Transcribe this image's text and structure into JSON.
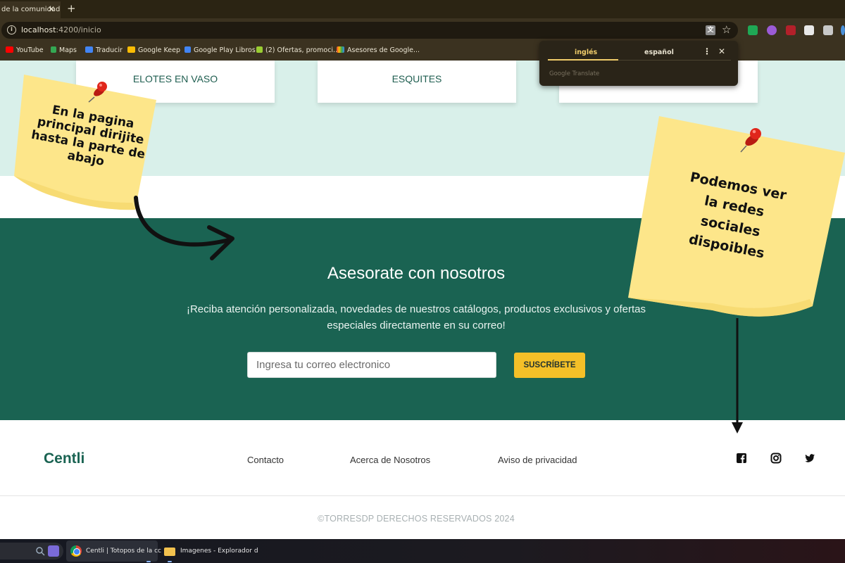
{
  "browser": {
    "tab_title": "de la comunidad",
    "tab_close": "✕",
    "new_tab": "+",
    "url_host": "localhost",
    "url_path": ":4200/inicio",
    "info": "i",
    "translate_glyph": "文",
    "star": "☆"
  },
  "bookmarks": [
    {
      "label": "YouTube",
      "color": "#ff0000"
    },
    {
      "label": "Maps",
      "color": "#34a853"
    },
    {
      "label": "Traducir",
      "color": "#4285f4"
    },
    {
      "label": "Google Keep",
      "color": "#fbbc04"
    },
    {
      "label": "Google Play Libros",
      "color": "#4285f4"
    },
    {
      "label": "(2) Ofertas, promoci...",
      "color": "#9acd32"
    },
    {
      "label": "Asesores de Google...",
      "color": "#ea4335"
    }
  ],
  "translate_popup": {
    "tab_active": "inglés",
    "tab_other": "español",
    "more": "⋮",
    "close": "✕",
    "caption": "Google Translate"
  },
  "cards": [
    "ELOTES EN VASO",
    "ESQUITES",
    ""
  ],
  "hero": {
    "title": "Asesorate con nosotros",
    "text": "¡Reciba atención personalizada, novedades de nuestros catálogos, productos exclusivos y ofertas especiales directamente en su correo!",
    "email_placeholder": "Ingresa tu correo electronico",
    "button": "SUSCRÍBETE"
  },
  "footer": {
    "brand": "Centli",
    "links": [
      "Contacto",
      "Acerca de Nosotros",
      "Aviso de privacidad"
    ],
    "social_icons": [
      "facebook-icon",
      "instagram-icon",
      "twitter-icon"
    ],
    "copyright": "©TORRESDP DERECHOS RESERVADOS 2024"
  },
  "taskbar": {
    "chrome_label": "Centli | Totopos de la cc",
    "explorer_label": "Imagenes - Explorador d"
  },
  "annotations": {
    "note_left": [
      "En la pagina",
      "principal dirijite",
      "hasta la parte de",
      "abajo"
    ],
    "note_right": [
      "Podemos ver",
      "la redes",
      "sociales",
      "dispoibles"
    ]
  },
  "colors": {
    "primary": "#1a6352",
    "accent": "#f4c028",
    "mint": "#d9f0ea",
    "note": "#fde68a",
    "pin": "#e0261b"
  }
}
